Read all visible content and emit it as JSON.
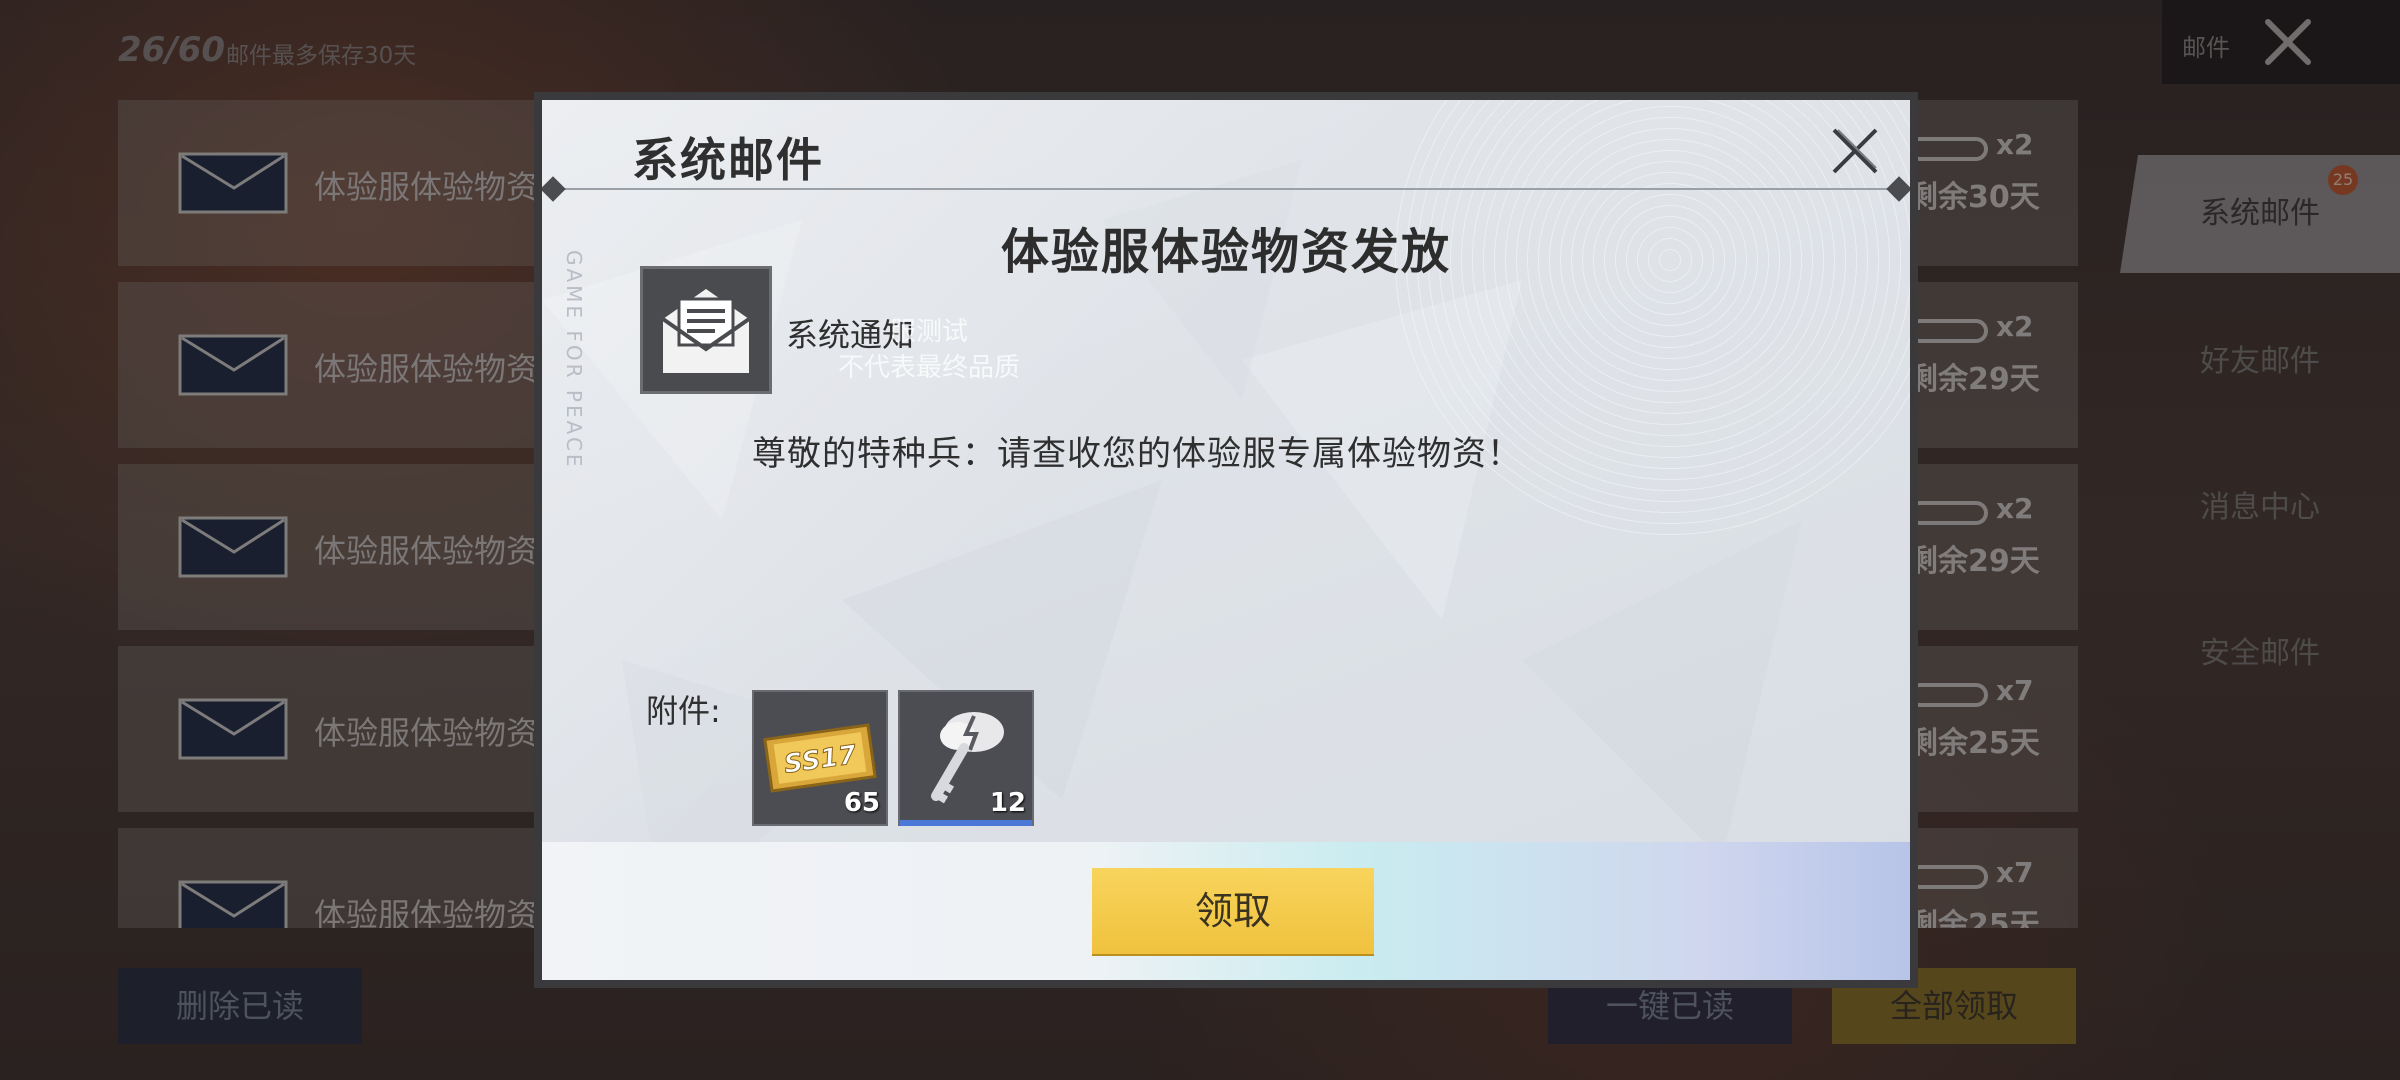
{
  "background": {
    "mail_count": "26/60",
    "keep_note": "邮件最多保存30天",
    "top_right_label": "邮件",
    "mail_rows": [
      {
        "title": "体验服体验物资",
        "qty": "x2",
        "days": "剩余30天"
      },
      {
        "title": "体验服体验物资",
        "qty": "x2",
        "days": "剩余29天"
      },
      {
        "title": "体验服体验物资",
        "qty": "x2",
        "days": "剩余29天"
      },
      {
        "title": "体验服体验物资",
        "qty": "x7",
        "days": "剩余25天"
      },
      {
        "title": "体验服体验物资",
        "qty": "x7",
        "days": "剩余25天"
      }
    ],
    "side_tabs": [
      {
        "label": "系统邮件",
        "badge": "25"
      },
      {
        "label": "好友邮件"
      },
      {
        "label": "消息中心"
      },
      {
        "label": "安全邮件"
      }
    ],
    "delete_read_label": "删除已读",
    "read_all_label": "一键已读",
    "claim_all_label": "全部领取"
  },
  "modal": {
    "title": "系统邮件",
    "vertical_text": "GAME FOR PEACE",
    "mail_heading": "体验服体验物资发放",
    "sender": "系统通知",
    "watermark_line1": "服测试",
    "watermark_line2": "不代表最终品质",
    "body": "尊敬的特种兵：请查收您的体验服专属体验物资！",
    "attachments_label": "附件:",
    "attachments": [
      {
        "icon": "ticket-icon",
        "label": "SS17",
        "qty": "65"
      },
      {
        "icon": "key-icon",
        "qty": "12"
      }
    ],
    "claim_label": "领取"
  },
  "colors": {
    "claim_button": "#f0c23e",
    "badge": "#c9582c",
    "modal_bg": "#dfe3e8"
  }
}
